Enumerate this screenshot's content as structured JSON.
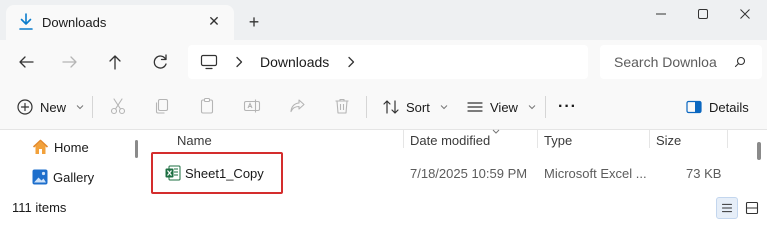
{
  "window": {
    "tab_title": "Downloads",
    "tab_close": "✕",
    "new_tab": "+"
  },
  "address": {
    "path": "Downloads",
    "search_placeholder": "Search Downloa"
  },
  "commands": {
    "new_label": "New",
    "sort_label": "Sort",
    "view_label": "View",
    "more_label": "···",
    "details_label": "Details"
  },
  "sidebar": {
    "items": [
      {
        "label": "Home",
        "icon": "home-icon"
      },
      {
        "label": "Gallery",
        "icon": "gallery-icon"
      }
    ]
  },
  "file_list": {
    "columns": [
      "Name",
      "Date modified",
      "Type",
      "Size"
    ],
    "rows": [
      {
        "name": "Sheet1_Copy",
        "date_modified": "7/18/2025 10:59 PM",
        "type": "Microsoft Excel ...",
        "size": "73 KB",
        "icon": "excel-file-icon",
        "highlighted": true
      }
    ]
  },
  "status": {
    "item_count": "111 items"
  },
  "colors": {
    "accent": "#0067c0",
    "highlight_border": "#d42d2d",
    "excel_green": "#1d6f42"
  }
}
